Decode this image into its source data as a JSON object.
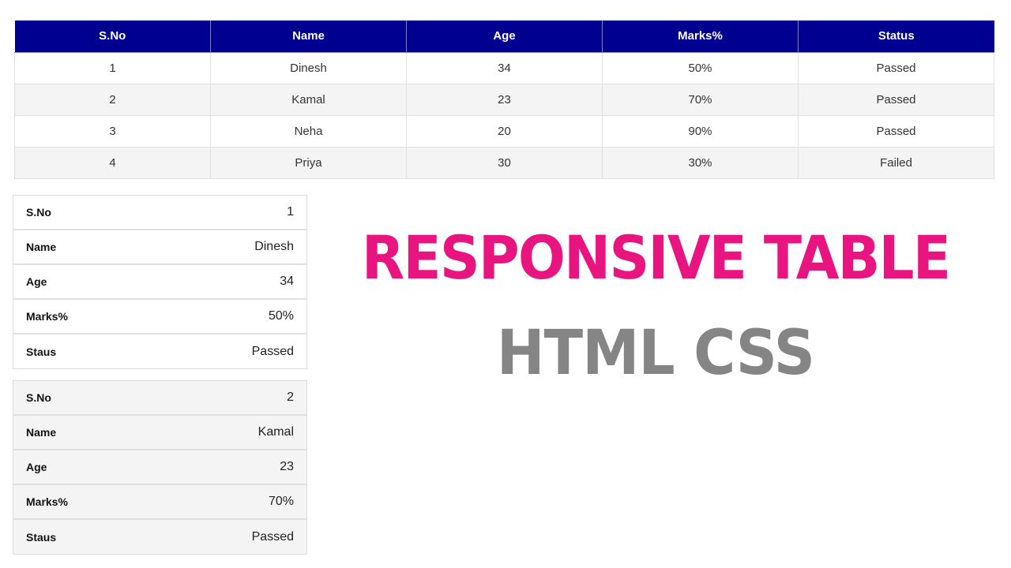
{
  "table": {
    "headers": [
      "S.No",
      "Name",
      "Age",
      "Marks%",
      "Status"
    ],
    "rows": [
      [
        "1",
        "Dinesh",
        "34",
        "50%",
        "Passed"
      ],
      [
        "2",
        "Kamal",
        "23",
        "70%",
        "Passed"
      ],
      [
        "3",
        "Neha",
        "20",
        "90%",
        "Passed"
      ],
      [
        "4",
        "Priya",
        "30",
        "30%",
        "Failed"
      ]
    ],
    "header_color": "#000090"
  },
  "cards": [
    {
      "rows": [
        {
          "label": "S.No",
          "value": "1"
        },
        {
          "label": "Name",
          "value": "Dinesh"
        },
        {
          "label": "Age",
          "value": "34"
        },
        {
          "label": "Marks%",
          "value": "50%"
        },
        {
          "label": "Staus",
          "value": "Passed"
        }
      ]
    },
    {
      "rows": [
        {
          "label": "S.No",
          "value": "2"
        },
        {
          "label": "Name",
          "value": "Kamal"
        },
        {
          "label": "Age",
          "value": "23"
        },
        {
          "label": "Marks%",
          "value": "70%"
        },
        {
          "label": "Staus",
          "value": "Passed"
        }
      ]
    }
  ],
  "title": {
    "line1": "RESPONSIVE TABLE",
    "line2": "HTML CSS",
    "line1_color": "#e8147f",
    "line2_color": "#858585"
  }
}
